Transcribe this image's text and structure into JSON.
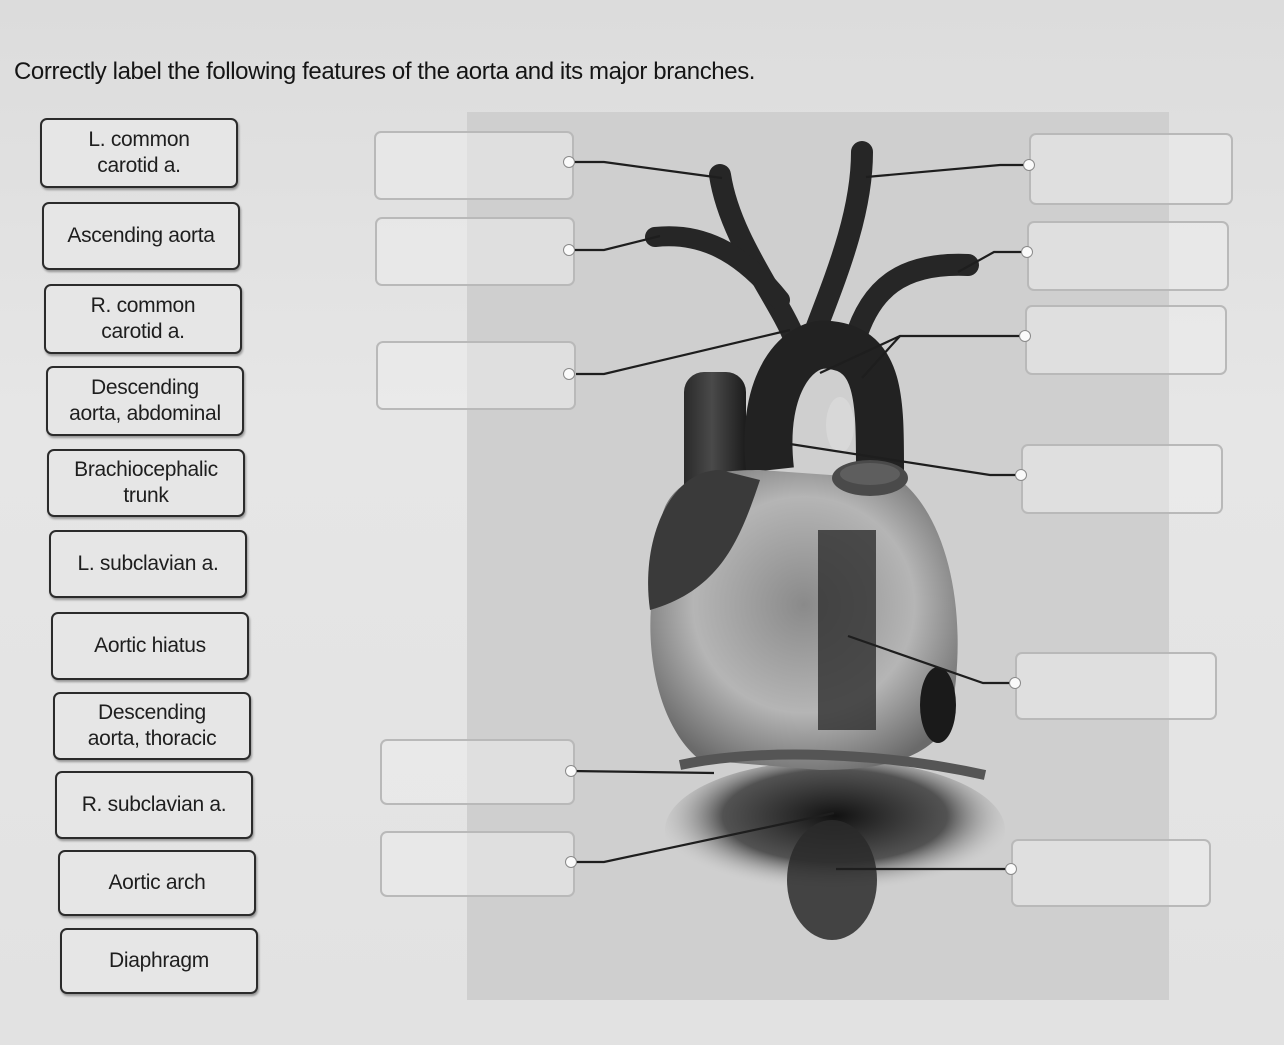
{
  "question": {
    "prompt": "Correctly label the following features of the aorta and its major branches."
  },
  "label_bank": [
    {
      "label": "L. common\ncarotid a."
    },
    {
      "label": "Ascending aorta"
    },
    {
      "label": "R. common\ncarotid a."
    },
    {
      "label": "Descending\naorta, abdominal"
    },
    {
      "label": "Brachiocephalic\ntrunk"
    },
    {
      "label": "L. subclavian a."
    },
    {
      "label": "Aortic hiatus"
    },
    {
      "label": "Descending\naorta, thoracic"
    },
    {
      "label": "R. subclavian a."
    },
    {
      "label": "Aortic arch"
    },
    {
      "label": "Diaphragm"
    }
  ],
  "figure": {
    "subject": "heart with aorta and major branches, anterior view",
    "drop_targets": [
      {
        "side": "left",
        "value": ""
      },
      {
        "side": "left",
        "value": ""
      },
      {
        "side": "left",
        "value": ""
      },
      {
        "side": "left",
        "value": ""
      },
      {
        "side": "left",
        "value": ""
      },
      {
        "side": "right",
        "value": ""
      },
      {
        "side": "right",
        "value": ""
      },
      {
        "side": "right",
        "value": ""
      },
      {
        "side": "right",
        "value": ""
      },
      {
        "side": "right",
        "value": ""
      },
      {
        "side": "right",
        "value": ""
      }
    ]
  }
}
